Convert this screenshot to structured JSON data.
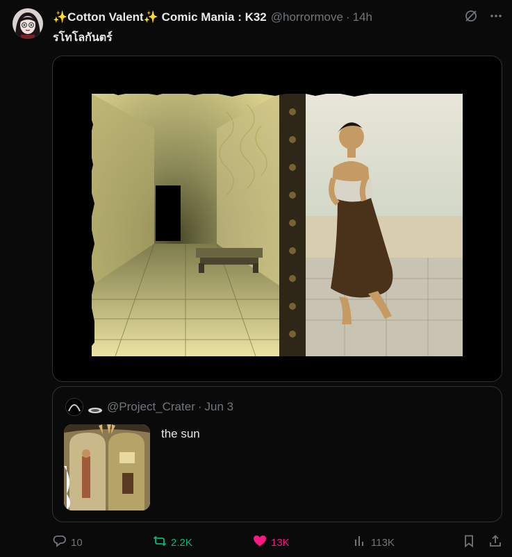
{
  "post": {
    "display_name": "✨Cotton Valent✨ Comic Mania : K32",
    "handle": "@horrormove",
    "time": "14h",
    "text": "รโทโลกันตร์"
  },
  "quote": {
    "handle": "@Project_Crater",
    "date": "Jun 3",
    "text": "the sun"
  },
  "stats": {
    "replies": "10",
    "reposts": "2.2K",
    "likes": "13K",
    "views": "113K"
  },
  "colors": {
    "repost_active": "#00ba7c",
    "like_active": "#f91880",
    "muted": "#71767b"
  },
  "icons": [
    "grok-icon",
    "more-icon",
    "reply-icon",
    "repost-icon",
    "heart-icon",
    "views-icon",
    "bookmark-icon",
    "share-icon"
  ]
}
